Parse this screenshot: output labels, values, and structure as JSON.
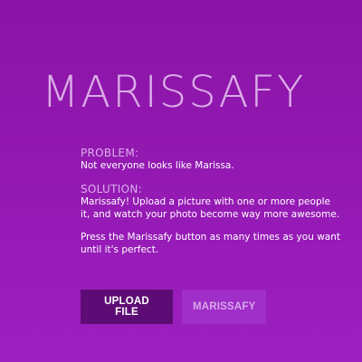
{
  "title": "MARISSAFY",
  "problem": {
    "label": "PROBLEM:",
    "text": "Not everyone looks like Marissa."
  },
  "solution": {
    "label": "SOLUTION:",
    "lines": [
      "Marissafy! Upload a picture with one or more people",
      "it, and watch your photo become way more awesome."
    ]
  },
  "instructions": {
    "lines": [
      "Press the Marissafy button as many times as you want",
      "until it's perfect."
    ]
  },
  "buttons": {
    "upload_label": "UPLOAD FILE",
    "marissafy_label": "MARISSAFY"
  }
}
